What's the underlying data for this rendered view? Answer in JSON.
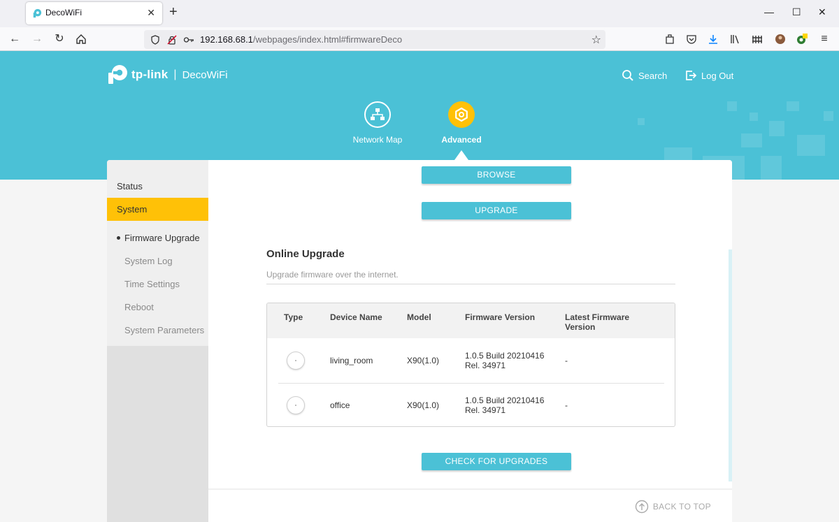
{
  "browser": {
    "tab_title": "DecoWiFi",
    "url_host": "192.168.68.1",
    "url_path": "/webpages/index.html#firmwareDeco"
  },
  "header": {
    "brand": "tp-link",
    "product": "DecoWiFi",
    "search_label": "Search",
    "logout_label": "Log Out"
  },
  "topnav": {
    "network_map_label": "Network Map",
    "advanced_label": "Advanced"
  },
  "sidebar": {
    "status_label": "Status",
    "system_label": "System",
    "sub_items": [
      "Firmware Upgrade",
      "System Log",
      "Time Settings",
      "Reboot",
      "System Parameters"
    ]
  },
  "main": {
    "browse_label": "BROWSE",
    "upgrade_label": "UPGRADE",
    "online_title": "Online Upgrade",
    "online_desc": "Upgrade firmware over the internet.",
    "check_label": "CHECK FOR UPGRADES",
    "back_to_top": "BACK TO TOP"
  },
  "table": {
    "headers": [
      "Type",
      "Device Name",
      "Model",
      "Firmware Version",
      "Latest Firmware Version"
    ],
    "rows": [
      {
        "device_name": "living_room",
        "model": "X90(1.0)",
        "firmware_line1": "1.0.5 Build 20210416",
        "firmware_line2": "Rel. 34971",
        "latest": "-"
      },
      {
        "device_name": "office",
        "model": "X90(1.0)",
        "firmware_line1": "1.0.5 Build 20210416",
        "firmware_line2": "Rel. 34971",
        "latest": "-"
      }
    ]
  },
  "colors": {
    "brand_teal": "#4bc1d6",
    "accent_yellow": "#ffc107"
  }
}
